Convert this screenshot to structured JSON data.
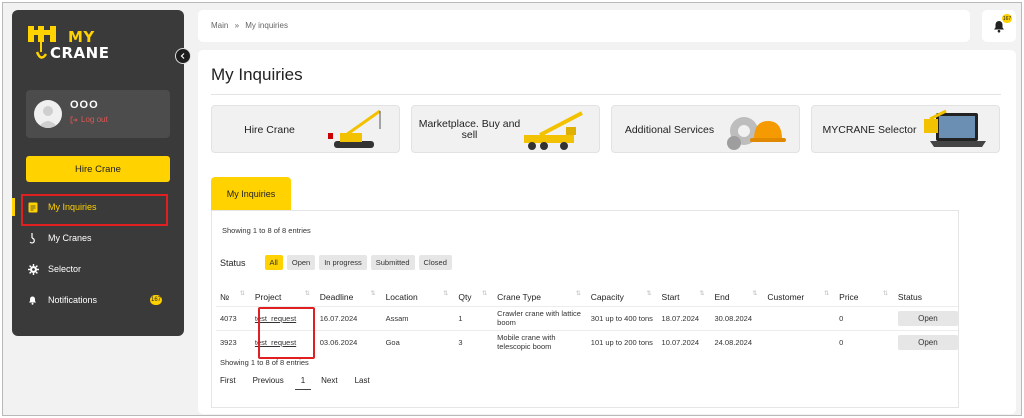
{
  "brand": {
    "line1": "MY",
    "line2": "CRANE"
  },
  "user": {
    "name": "OOO",
    "logout": "Log out"
  },
  "sidebar": {
    "hire_button": "Hire Crane",
    "items": [
      {
        "label": "My Inquiries",
        "icon": "document-icon",
        "active": true
      },
      {
        "label": "My Cranes",
        "icon": "hook-icon"
      },
      {
        "label": "Selector",
        "icon": "gear-icon"
      },
      {
        "label": "Notifications",
        "icon": "bell-icon",
        "badge": "167"
      }
    ]
  },
  "topbar": {
    "breadcrumb": [
      "Main",
      "My inquiries"
    ],
    "separator": "»",
    "bell_badge": "167"
  },
  "main": {
    "title": "My Inquiries",
    "cards": [
      {
        "label": "Hire Crane",
        "image": "crawler-crane-image"
      },
      {
        "label": "Marketplace. Buy and sell",
        "image": "crane-truck-image"
      },
      {
        "label": "Additional Services",
        "image": "gears-helmet-image"
      },
      {
        "label": "MYCRANE Selector",
        "image": "laptop-crane-image"
      }
    ],
    "tab": "My Inquiries",
    "showing_top": "Showing 1 to 8 of 8 entries",
    "showing_bottom": "Showing 1 to 8 of 8 entries",
    "status_label": "Status",
    "status_filters": [
      {
        "label": "All",
        "selected": true
      },
      {
        "label": "Open"
      },
      {
        "label": "In progress"
      },
      {
        "label": "Submitted"
      },
      {
        "label": "Closed"
      }
    ],
    "table": {
      "columns": [
        "№",
        "Project",
        "Deadline",
        "Location",
        "Qty",
        "Crane Type",
        "Capacity",
        "Start",
        "End",
        "Customer",
        "Price",
        "Status"
      ],
      "rows": [
        {
          "no": "4073",
          "project": "test_request",
          "deadline": "16.07.2024",
          "location": "Assam",
          "qty": "1",
          "crane_type": "Crawler crane with lattice boom",
          "capacity": "301 up to 400 tons",
          "start": "18.07.2024",
          "end": "30.08.2024",
          "customer": "",
          "price": "0",
          "status": "Open"
        },
        {
          "no": "3923",
          "project": "test_request",
          "deadline": "03.06.2024",
          "location": "Goa",
          "qty": "3",
          "crane_type": "Mobile crane with telescopic boom",
          "capacity": "101 up to 200 tons",
          "start": "10.07.2024",
          "end": "24.08.2024",
          "customer": "",
          "price": "0",
          "status": "Open"
        }
      ]
    },
    "pagination": {
      "first": "First",
      "previous": "Previous",
      "current": "1",
      "next": "Next",
      "last": "Last"
    }
  },
  "colors": {
    "accent": "#ffd200",
    "sidebar_bg": "#3a3a3a",
    "highlight": "#e02020"
  }
}
